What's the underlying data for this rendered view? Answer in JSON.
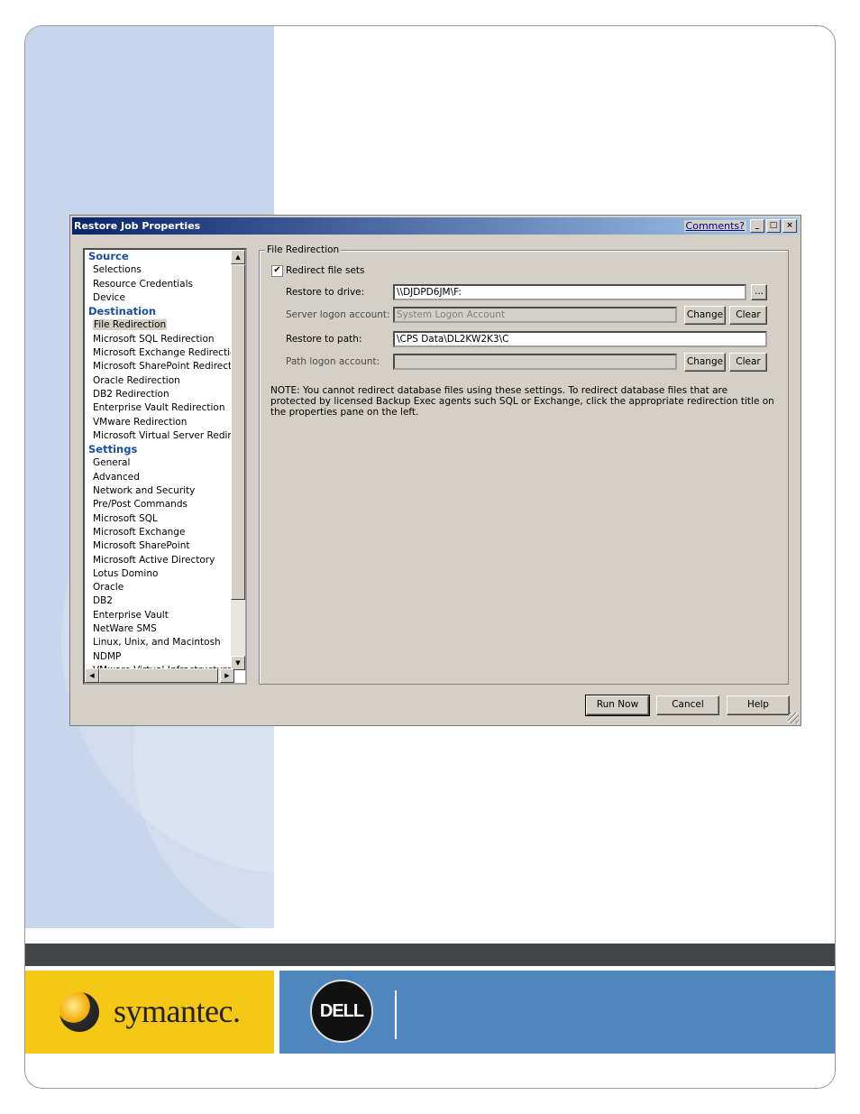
{
  "dialog": {
    "title": "Restore Job Properties",
    "comments_link": "Comments?",
    "title_buttons": {
      "minimize": "_",
      "maximize": "□",
      "close": "×"
    }
  },
  "tree": {
    "sections": [
      {
        "title": "Source",
        "items": [
          "Selections",
          "Resource Credentials",
          "Device"
        ]
      },
      {
        "title": "Destination",
        "items": [
          "File Redirection",
          "Microsoft SQL Redirection",
          "Microsoft Exchange Redirection",
          "Microsoft SharePoint Redirection",
          "Oracle Redirection",
          "DB2 Redirection",
          "Enterprise Vault Redirection",
          "VMware Redirection",
          "Microsoft Virtual Server Redirection"
        ]
      },
      {
        "title": "Settings",
        "items": [
          "General",
          "Advanced",
          "Network and Security",
          "Pre/Post Commands",
          "Microsoft SQL",
          "Microsoft Exchange",
          "Microsoft SharePoint",
          "Microsoft Active Directory",
          "Lotus Domino",
          "Oracle",
          "DB2",
          "Enterprise Vault",
          "NetWare SMS",
          "Linux, Unix, and Macintosh",
          "NDMP",
          "VMware Virtual Infrastructure"
        ]
      }
    ],
    "selected_item": "File Redirection"
  },
  "file_redirection": {
    "group_label": "File Redirection",
    "redirect_checkbox_label": "Redirect file sets",
    "redirect_checked": true,
    "restore_to_drive_label": "Restore to drive:",
    "restore_to_drive_value": "\\\\DJDPD6JM\\F:",
    "browse_label": "...",
    "server_logon_label": "Server logon account:",
    "server_logon_value": "System Logon Account",
    "restore_to_path_label": "Restore to path:",
    "restore_to_path_value": "\\CPS Data\\DL2KW2K3\\C",
    "path_logon_label": "Path logon account:",
    "path_logon_value": "",
    "change_label": "Change",
    "clear_label": "Clear",
    "note": "NOTE: You cannot redirect database files using these settings. To redirect database files that are protected by licensed Backup Exec agents such SQL or Exchange, click the appropriate redirection title on the properties pane on the left."
  },
  "buttons": {
    "run_now": "Run Now",
    "cancel": "Cancel",
    "help": "Help"
  },
  "footer": {
    "symantec_logo": "symantec.",
    "dell_logo": "DELL"
  },
  "colors": {
    "band": "#c7d6ec",
    "footer_bar": "#434448",
    "symantec_yellow": "#f6c816",
    "dell_blue": "#4e86be",
    "section_blue": "#1a4fa0"
  }
}
